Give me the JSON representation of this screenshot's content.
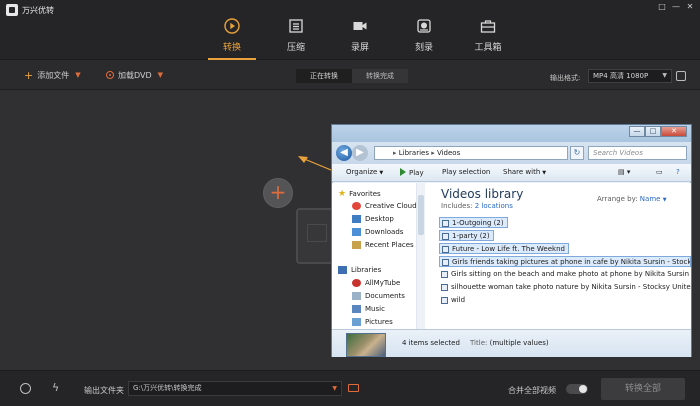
{
  "app": {
    "title": "万兴优转",
    "window_controls": [
      "□",
      "—",
      "✕"
    ]
  },
  "nav": [
    {
      "label": "转换",
      "icon": "convert-play-icon",
      "active": true
    },
    {
      "label": "压缩",
      "icon": "compress-icon",
      "active": false
    },
    {
      "label": "录屏",
      "icon": "record-camera-icon",
      "active": false
    },
    {
      "label": "刻录",
      "icon": "burn-disc-icon",
      "active": false
    },
    {
      "label": "工具箱",
      "icon": "toolbox-icon",
      "active": false
    }
  ],
  "toolbar": {
    "add_files": "添加文件",
    "load_dvd": "加载DVD",
    "tabs": [
      "正在转换",
      "转换完成"
    ],
    "output_format_label": "输出格式:",
    "output_format_value": "MP4 高清 1080P"
  },
  "explorer": {
    "title_controls": [
      "—",
      "□",
      "✕"
    ],
    "breadcrumb": [
      "Libraries",
      "Videos"
    ],
    "search_placeholder": "Search Videos",
    "commands": [
      "Organize",
      "Play",
      "Play selection",
      "Share with"
    ],
    "nav": {
      "favorites_label": "Favorites",
      "favorites": [
        "Creative Cloud Fi",
        "Desktop",
        "Downloads",
        "Recent Places"
      ],
      "libraries_label": "Libraries",
      "libraries": [
        "AllMyTube",
        "Documents",
        "Music",
        "Pictures"
      ]
    },
    "library_title": "Videos library",
    "includes_label": "Includes:",
    "includes_value": "2 locations",
    "arrange_label": "Arrange by:",
    "arrange_value": "Name",
    "files": [
      {
        "name": "1-Outgoing (2)",
        "selected": true
      },
      {
        "name": "1-party (2)",
        "selected": true
      },
      {
        "name": "Future - Low Life ft. The Weeknd",
        "selected": true
      },
      {
        "name": "Girls friends taking pictures at phone in cafe by Nikita Sursin - Stocksy United",
        "selected": true
      },
      {
        "name": "Girls sitting on the beach and make photo at phone by Nikita Sursin - Stocksy United",
        "selected": false
      },
      {
        "name": "silhouette woman take photo nature by Nikita Sursin - Stocksy United",
        "selected": false
      },
      {
        "name": "wild",
        "selected": false
      }
    ],
    "details_count": "4 items selected",
    "details_title_label": "Title:",
    "details_title_value": "(multiple values)"
  },
  "bottom": {
    "output_folder_label": "输出文件夹",
    "output_folder_path": "G:\\万兴优转\\转换完成",
    "merge_label": "合并全部视频",
    "convert_all": "转换全部"
  },
  "colors": {
    "accent": "#e9a23b",
    "accent_red": "#e06c3b",
    "background": "#2e2e30"
  }
}
